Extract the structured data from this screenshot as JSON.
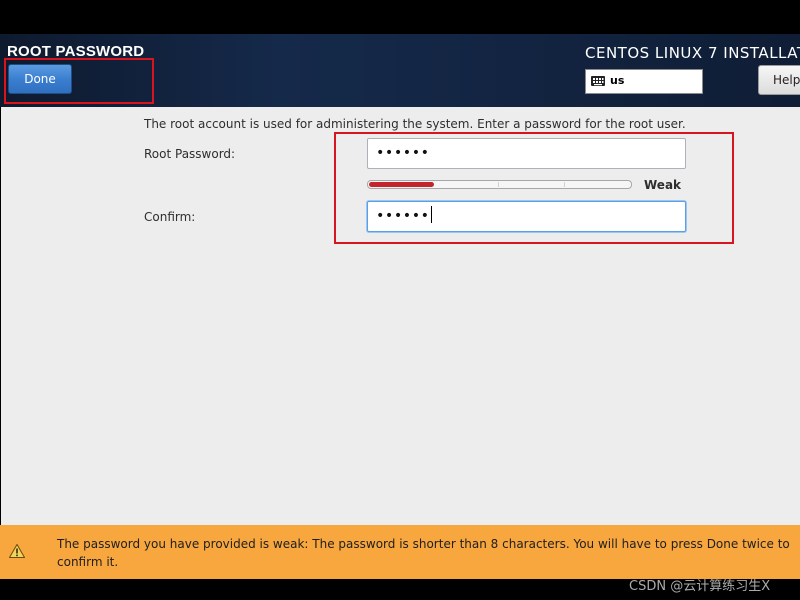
{
  "header": {
    "title": "ROOT PASSWORD",
    "done_label": "Done",
    "product_name": "CENTOS LINUX 7 INSTALLATI",
    "keyboard_layout": "us",
    "help_label": "Help"
  },
  "form": {
    "intro_text": "The root account is used for administering the system.  Enter a password for the root user.",
    "root_password_label": "Root Password:",
    "root_password_value": "••••••",
    "confirm_label": "Confirm:",
    "confirm_value": "••••••",
    "strength_label": "Weak",
    "strength_level": 0.25
  },
  "warning": {
    "icon": "warning-triangle-icon",
    "text": "The password you have provided is weak: The password is shorter than 8 characters. You will have to press Done twice to confirm it."
  },
  "watermark": {
    "text": "CSDN @云计算练习生X"
  },
  "colors": {
    "header_bg": "#132543",
    "done_button": "#3b7fd0",
    "annotation_red": "#d8141e",
    "strength_weak": "#c4242b",
    "warning_bg": "#f8a63e",
    "content_bg": "#ededed"
  }
}
